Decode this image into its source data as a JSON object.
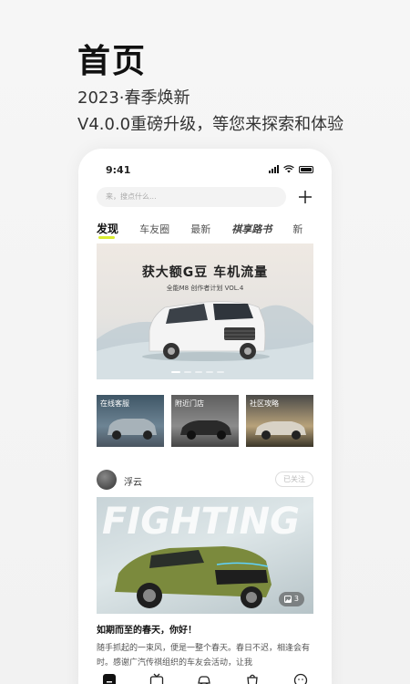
{
  "hero": {
    "title": "首页",
    "subtitle": "2023·春季焕新",
    "tagline": "V4.0.0重磅升级，等您来探索和体验"
  },
  "status_bar": {
    "time": "9:41"
  },
  "search": {
    "placeholder": "来，搜点什么..."
  },
  "tabs": [
    "发现",
    "车友圈",
    "最新",
    "祺享路书",
    "新"
  ],
  "active_tab": "发现",
  "banner": {
    "title": "获大额G豆 车机流量",
    "subtitle": "全能M8 创作者计划 VOL.4",
    "slide_count": 5,
    "active_slide": 1
  },
  "shortcuts": [
    {
      "label": "在线客服"
    },
    {
      "label": "附近门店"
    },
    {
      "label": "社区攻略"
    }
  ],
  "post": {
    "user": "浮云",
    "follow_label": "已关注",
    "image_text": "FIGHTING",
    "image_count": "3",
    "title": "如期而至的春天，你好！",
    "body": "随手抓起的一束风，便是一整个春天。春日不迟，相逢会有时。感谢广汽传祺组织的车友会活动，让我"
  },
  "colors": {
    "accent": "#d9ec2f",
    "text_primary": "#111111",
    "text_secondary": "#555555"
  }
}
